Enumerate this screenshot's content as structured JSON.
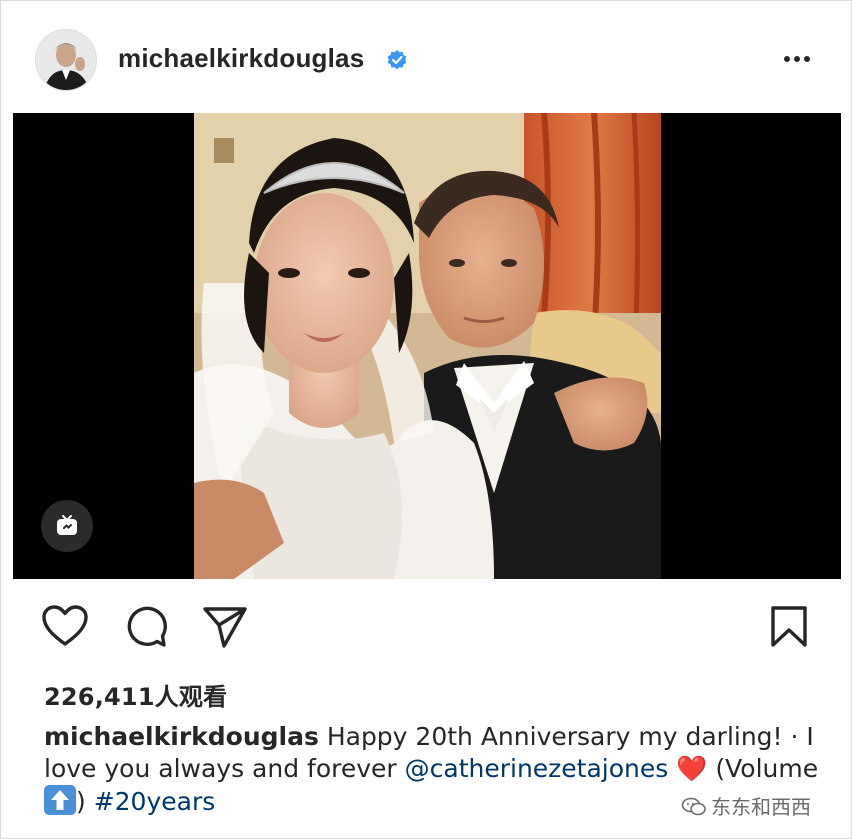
{
  "header": {
    "username": "michaelkirkdouglas",
    "avatar_icon": "profile-photo",
    "verified_icon": "verified-badge-icon",
    "more_icon": "more-options-icon"
  },
  "media": {
    "igtv_icon": "igtv-icon"
  },
  "actions": {
    "like_icon": "heart-icon",
    "comment_icon": "comment-icon",
    "share_icon": "send-icon",
    "save_icon": "bookmark-icon"
  },
  "stats": {
    "views": "226,411人观看"
  },
  "caption": {
    "username": "michaelkirkdouglas",
    "text_1": " Happy 20th Anniversary my darling! · I love you always and forever ",
    "mention": "@catherinezetajones",
    "text_2": " ",
    "heart_emoji": "❤️",
    "text_3": " (Volume ",
    "volume_emoji": "⬆️",
    "text_4": ") ",
    "hashtag": "#20years"
  },
  "watermark": {
    "text": "东东和西西"
  },
  "colors": {
    "link": "#00376b",
    "verified": "#3897f0",
    "text": "#262626"
  }
}
